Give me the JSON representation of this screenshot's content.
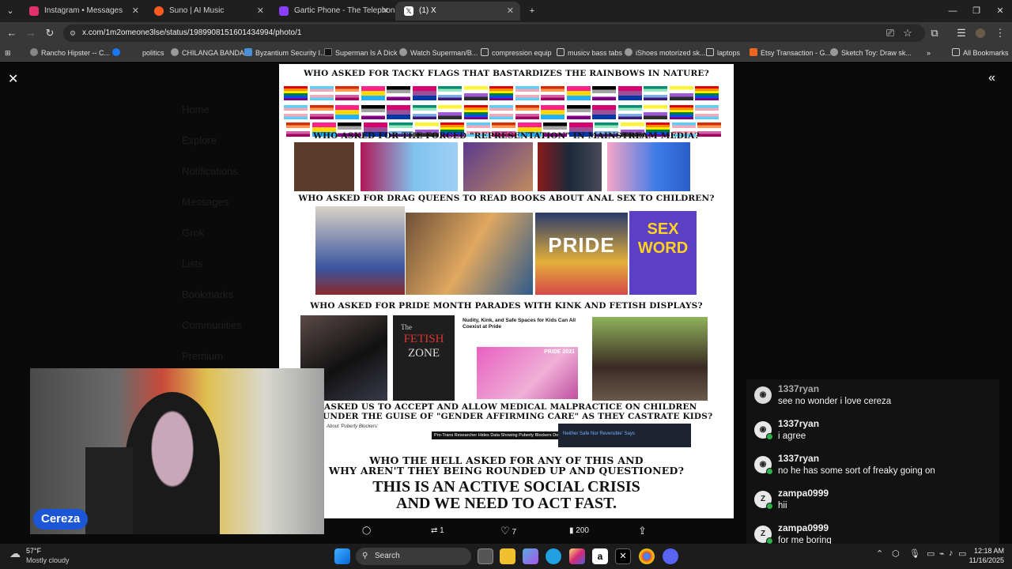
{
  "tabs": [
    {
      "label": "Instagram • Messages",
      "color": "#e1306c"
    },
    {
      "label": "Suno | AI Music",
      "color": "#ff5a1f"
    },
    {
      "label": "Gartic Phone - The Telephone G",
      "color": "#8a3ffc"
    },
    {
      "label": "(1) X",
      "color": "#ffffff"
    }
  ],
  "url": "x.com/1m2omeone3lse/status/1989908151601434994/photo/1",
  "bookmarks": [
    "Rancho Hipster -- C...",
    "politics",
    "CHILANGA BANDA",
    "Byzantium Security I...",
    "Superman Is A Dick",
    "Watch Superman/B...",
    "compression equip",
    "musicv bass tabs",
    "iShoes motorized sk...",
    "laptops",
    "Etsy Transaction - G...",
    "Sketch Toy: Draw sk...",
    "All Bookmarks"
  ],
  "ghost_nav": [
    "Home",
    "Explore",
    "Notifications",
    "Messages",
    "Grok",
    "Lists",
    "Bookmarks",
    "Communities",
    "Premium"
  ],
  "meme": {
    "h1": "WHO ASKED FOR TACKY FLAGS THAT BASTARDIZES THE RAINBOWS IN NATURE?",
    "h2": "WHO ASKED FOR THE FORCED \"REPRESENTATION\" IN MAINSTREAM MEDIA?",
    "h3": "WHO ASKED FOR DRAG QUEENS TO READ BOOKS ABOUT ANAL SEX TO CHILDREN?",
    "h4": "WHO ASKED FOR PRIDE MONTH PARADES WITH KINK AND FETISH DISPLAYS?",
    "h5a": "ASKED US TO ACCEPT AND ALLOW MEDICAL MALPRACTICE ON CHILDREN",
    "h5b": "UNDER THE GUISE OF \"GENDER AFFIRMING CARE\" AS THEY CASTRATE KIDS?",
    "h6a": "WHO THE HELL ASKED FOR ANY OF THIS AND",
    "h6b": "WHY AREN'T THEY BEING ROUNDED UP AND QUESTIONED?",
    "big1": "THIS IS AN ACTIVE SOCIAL CRISIS",
    "big2": "AND WE NEED TO ACT FAST.",
    "sign_a": "The",
    "sign_b": "FETISH",
    "sign_c": "ZONE",
    "book_a": "SEX",
    "book_b": "WORD",
    "book_c": "PRIDE",
    "article_title": "Nudity, Kink, and Safe Spaces for Kids Can All Coexist at Pride",
    "article_year": "PRIDE 2021",
    "puberty": "About 'Puberty Blockers'",
    "news_strip": "Pro-Trans Researcher Hides Data Showing Puberty Blockers Don't Work",
    "news_box": "Neither Safe Nor Reversible' Says"
  },
  "actions": {
    "retweets": "1",
    "likes": "7",
    "views": "200"
  },
  "streamer": {
    "name": "Cereza"
  },
  "chat": [
    {
      "user": "1337ryan",
      "text": "see no wonder i love cereza",
      "initial": ""
    },
    {
      "user": "1337ryan",
      "text": "i agree",
      "initial": ""
    },
    {
      "user": "1337ryan",
      "text": "no he has some sort of freaky going on",
      "initial": ""
    },
    {
      "user": "zampa0999",
      "text": "hii",
      "initial": "Z"
    },
    {
      "user": "zampa0999",
      "text": "for me boring",
      "initial": "Z"
    }
  ],
  "taskbar": {
    "weather_temp": "57°F",
    "weather_desc": "Mostly cloudy",
    "search_label": "Search",
    "time": "12:18 AM",
    "date": "11/16/2025"
  }
}
